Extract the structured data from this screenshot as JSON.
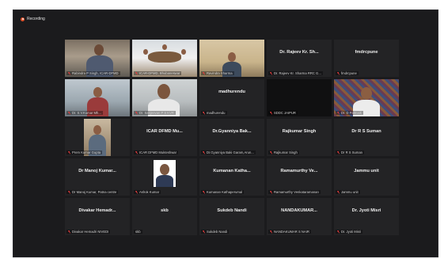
{
  "recording": {
    "label": "Recording"
  },
  "tiles": [
    {
      "name": "Rabindra P Singh, ICAR-DFMD",
      "mic_off": true,
      "video": true
    },
    {
      "name": "ICAR-DFMD, Bhubaneswar",
      "mic_off": true,
      "video": true,
      "active": true
    },
    {
      "name": "Ravindra Sharma",
      "mic_off": true,
      "video": true
    },
    {
      "title": "Dr. Rajeev Kr. Sh...",
      "name": "Dr. Rajeev Kr. Sharma RRC G...",
      "mic_off": true,
      "video": false
    },
    {
      "title": "fmdrcpune",
      "name": "fmdrcpune",
      "mic_off": true,
      "video": false
    },
    {
      "name": "Dr. S.V.Kumar Mh...",
      "mic_off": true,
      "video": true
    },
    {
      "name": "Dr. Sanjeevan P S KVR",
      "mic_off": true,
      "video": true
    },
    {
      "title": "madhurendu",
      "name": "madhurendu",
      "mic_off": true,
      "video": false
    },
    {
      "title": "",
      "name": "SDDC JAIPUR",
      "mic_off": true,
      "video": false
    },
    {
      "name": "Dr. D Pattnaik",
      "mic_off": true,
      "video": true
    },
    {
      "name": "Prem Kumar Gupta",
      "mic_off": true,
      "video": true
    },
    {
      "title": "ICAR DFMD Mu...",
      "name": "ICAR DFMD Mukteshwar",
      "mic_off": true,
      "video": false
    },
    {
      "title": "Dr.Gyanniya Bak...",
      "name": "Dr.Gyanniya Baki Garam,Arun...",
      "mic_off": true,
      "video": false
    },
    {
      "title": "Rajkumar Singh",
      "name": "Rajkumar Singh",
      "mic_off": true,
      "video": false
    },
    {
      "title": "Dr R S Suman",
      "name": "Dr R S Suman",
      "mic_off": true,
      "video": false
    },
    {
      "title": "Dr Manoj Kumar...",
      "name": "Dr Manoj Kumar, Patna centre",
      "mic_off": true,
      "video": false
    },
    {
      "name": "Ashok Kumar",
      "mic_off": true,
      "video": true
    },
    {
      "title": "Kumanan Katha...",
      "name": "Kumanan Kathaperumal",
      "mic_off": true,
      "video": false
    },
    {
      "title": "Ramamurthy Ve...",
      "name": "Ramamurthy Venkataramanan",
      "mic_off": true,
      "video": false
    },
    {
      "title": "Jammu unit",
      "name": "Jammu unit",
      "mic_off": true,
      "video": false
    },
    {
      "title": "Divakar Hemadr...",
      "name": "Divakar Hemadri NIVEDI",
      "mic_off": true,
      "video": false
    },
    {
      "title": "skb",
      "name": "skb",
      "mic_off": false,
      "video": false
    },
    {
      "title": "Sukdeb Nandi",
      "name": "Sukdeb Nandi",
      "mic_off": true,
      "video": false
    },
    {
      "title": "NANDAKUMAR...",
      "name": "NANDAKUMAR S NAIR",
      "mic_off": true,
      "video": false
    },
    {
      "title": "Dr. Jyoti Misri",
      "name": "Dr. Jyoti Misri",
      "mic_off": true,
      "video": false
    }
  ],
  "colors": {
    "active_border": "#c8e04a",
    "mic_off": "#e23b3b",
    "background": "#1b1b1d",
    "tile": "#232325"
  }
}
